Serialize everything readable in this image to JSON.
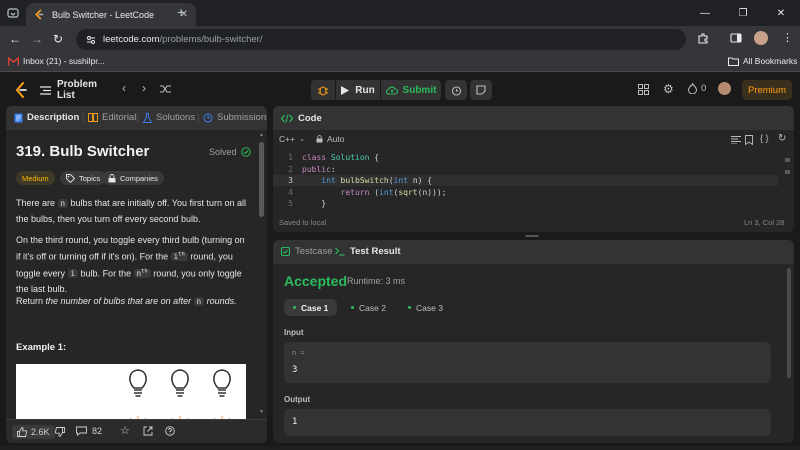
{
  "browser": {
    "tab_title": "Bulb Switcher - LeetCode",
    "url_host": "leetcode.com",
    "url_path": "/problems/bulb-switcher/",
    "bookmark_inbox": "Inbox (21) - sushilpr...",
    "bookmarks_all": "All Bookmarks"
  },
  "nav": {
    "problem_list": "Problem List",
    "run": "Run",
    "submit": "Submit",
    "streak": "0",
    "premium": "Premium"
  },
  "desc": {
    "tabs": [
      "Description",
      "Editorial",
      "Solutions",
      "Submissions"
    ],
    "title": "319. Bulb Switcher",
    "solved": "Solved",
    "difficulty": "Medium",
    "topics": "Topics",
    "companies": "Companies",
    "p1_a": "There are ",
    "p1_code": "n",
    "p1_b": " bulbs that are initially off. You first turn on all the bulbs, then you turn off every second bulb.",
    "p2_a": "On the third round, you toggle every third bulb (turning on if it's off or turning off if it's on). For the ",
    "p2_code1_base": "i",
    "p2_code1_sup": "th",
    "p2_b": " round, you toggle every ",
    "p2_code2": "i",
    "p2_c": " bulb. For the ",
    "p2_code3_base": "n",
    "p2_code3_sup": "th",
    "p2_d": " round, you only toggle the last bulb.",
    "p3_a": "Return ",
    "p3_em": "the number of bulbs that are on after",
    "p3_code": "n",
    "p3_b": " rounds.",
    "example_title": "Example 1:",
    "likes": "2.6K",
    "comments": "82"
  },
  "code": {
    "header": "Code",
    "language": "C++",
    "mode": "Auto",
    "lines": [
      {
        "num": "1",
        "text": "class Solution {"
      },
      {
        "num": "2",
        "text": "public:"
      },
      {
        "num": "3",
        "text": "    int bulbSwitch(int n) {"
      },
      {
        "num": "4",
        "text": "        return (int(sqrt(n)));"
      },
      {
        "num": "5",
        "text": "    }"
      }
    ],
    "saved": "Saved to local",
    "cursor": "Ln 3, Col 28"
  },
  "result": {
    "tab_testcase": "Testcase",
    "tab_result": "Test Result",
    "status": "Accepted",
    "runtime": "Runtime: 3 ms",
    "cases": [
      "Case 1",
      "Case 2",
      "Case 3"
    ],
    "input_label": "Input",
    "input_var": "n =",
    "input_value": "3",
    "output_label": "Output",
    "output_value": "1"
  },
  "colors": {
    "accepted": "#2cbb5d",
    "medium": "#ffb800",
    "premium": "#ffa116"
  }
}
